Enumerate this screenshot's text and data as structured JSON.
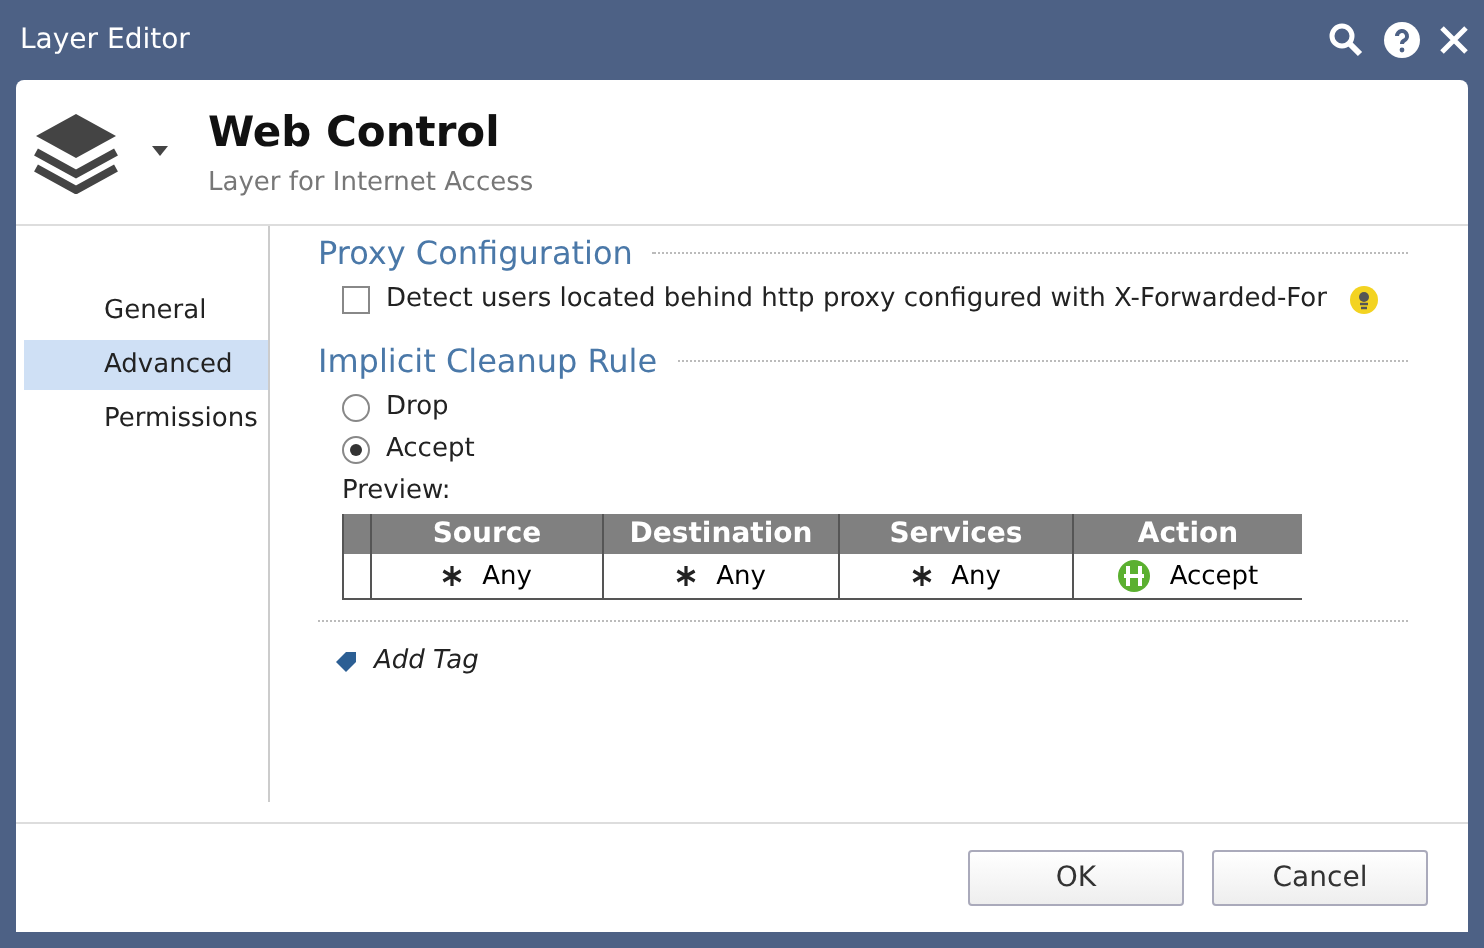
{
  "window": {
    "title": "Layer Editor"
  },
  "header": {
    "title": "Web Control",
    "subtitle": "Layer for Internet Access"
  },
  "sidebar": {
    "items": [
      {
        "label": "General",
        "selected": false
      },
      {
        "label": "Advanced",
        "selected": true
      },
      {
        "label": "Permissions",
        "selected": false
      }
    ]
  },
  "proxy": {
    "heading": "Proxy Configuration",
    "checkbox": {
      "label": "Detect users located behind http proxy configured with X-Forwarded-For",
      "checked": false
    }
  },
  "cleanup": {
    "heading": "Implicit Cleanup Rule",
    "options": [
      {
        "label": "Drop",
        "selected": false
      },
      {
        "label": "Accept",
        "selected": true
      }
    ],
    "preview_label": "Preview:",
    "table": {
      "columns": [
        "Source",
        "Destination",
        "Services",
        "Action"
      ],
      "row": [
        {
          "kind": "any",
          "text": "Any"
        },
        {
          "kind": "any",
          "text": "Any"
        },
        {
          "kind": "any",
          "text": "Any"
        },
        {
          "kind": "accept",
          "text": "Accept"
        }
      ]
    }
  },
  "add_tag": "Add Tag",
  "buttons": [
    "OK",
    "Cancel"
  ]
}
